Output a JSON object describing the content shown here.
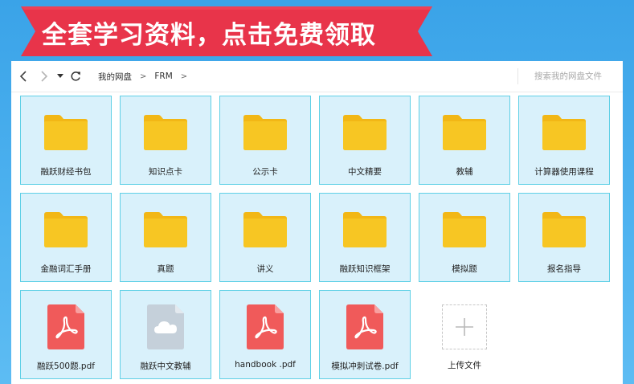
{
  "banner": {
    "text": "全套学习资料，点击免费领取",
    "ribbon_color": "#e8344a"
  },
  "toolbar": {
    "back_icon": "chevron-left-icon",
    "forward_icon": "chevron-right-icon",
    "history_icon": "caret-down-icon",
    "refresh_icon": "refresh-icon",
    "breadcrumb": [
      "我的网盘",
      "FRM"
    ],
    "breadcrumb_sep": ">",
    "search_placeholder": "搜索我的网盘文件"
  },
  "items": [
    {
      "label": "融跃财经书包",
      "type": "folder"
    },
    {
      "label": "知识点卡",
      "type": "folder"
    },
    {
      "label": "公示卡",
      "type": "folder"
    },
    {
      "label": "中文精要",
      "type": "folder"
    },
    {
      "label": "教辅",
      "type": "folder"
    },
    {
      "label": "计算器使用课程",
      "type": "folder"
    },
    {
      "label": "金融词汇手册",
      "type": "folder"
    },
    {
      "label": "真题",
      "type": "folder"
    },
    {
      "label": "讲义",
      "type": "folder"
    },
    {
      "label": "融跃知识框架",
      "type": "folder"
    },
    {
      "label": "模拟题",
      "type": "folder"
    },
    {
      "label": "报名指导",
      "type": "folder"
    },
    {
      "label": "融跃500题.pdf",
      "type": "pdf"
    },
    {
      "label": "融跃中文教辅",
      "type": "cloud-file"
    },
    {
      "label": "handbook .pdf",
      "type": "pdf"
    },
    {
      "label": "模拟冲刺试卷.pdf",
      "type": "pdf"
    }
  ],
  "upload": {
    "label": "上传文件",
    "icon": "plus-icon"
  },
  "colors": {
    "folder": "#f7c623",
    "folder_tab": "#f2b716",
    "pdf": "#f05a5a",
    "cloud_file": "#c5d0da",
    "tile_bg": "#d9f1fb",
    "tile_border": "#5fd0e6"
  }
}
